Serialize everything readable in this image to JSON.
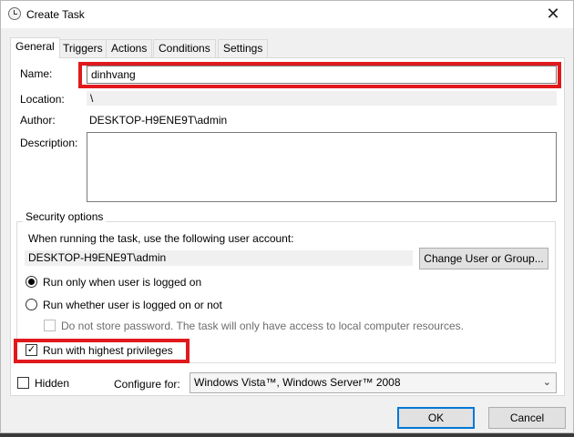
{
  "window": {
    "title": "Create Task",
    "close_glyph": "✕"
  },
  "tabs": [
    {
      "label": "General",
      "active": true
    },
    {
      "label": "Triggers"
    },
    {
      "label": "Actions"
    },
    {
      "label": "Conditions"
    },
    {
      "label": "Settings"
    }
  ],
  "general": {
    "name_label": "Name:",
    "name_value": "dinhvang",
    "location_label": "Location:",
    "location_value": "\\",
    "author_label": "Author:",
    "author_value": "DESKTOP-H9ENE9T\\admin",
    "description_label": "Description:",
    "description_value": ""
  },
  "security": {
    "group_title": "Security options",
    "account_prompt": "When running the task, use the following user account:",
    "account_value": "DESKTOP-H9ENE9T\\admin",
    "change_user_button": "Change User or Group...",
    "run_logged_on": "Run only when user is logged on",
    "run_whether": "Run whether user is logged on or not",
    "do_not_store": "Do not store password.  The task will only have access to local computer resources.",
    "highest_privileges": "Run with highest privileges",
    "check_glyph": "✓"
  },
  "bottom": {
    "hidden_label": "Hidden",
    "configure_label": "Configure for:",
    "configure_value": "Windows Vista™, Windows Server™ 2008",
    "arrow_glyph": "⌄"
  },
  "buttons": {
    "ok": "OK",
    "cancel": "Cancel"
  },
  "colors": {
    "highlight": "#e0191d",
    "accent": "#0078d7"
  }
}
